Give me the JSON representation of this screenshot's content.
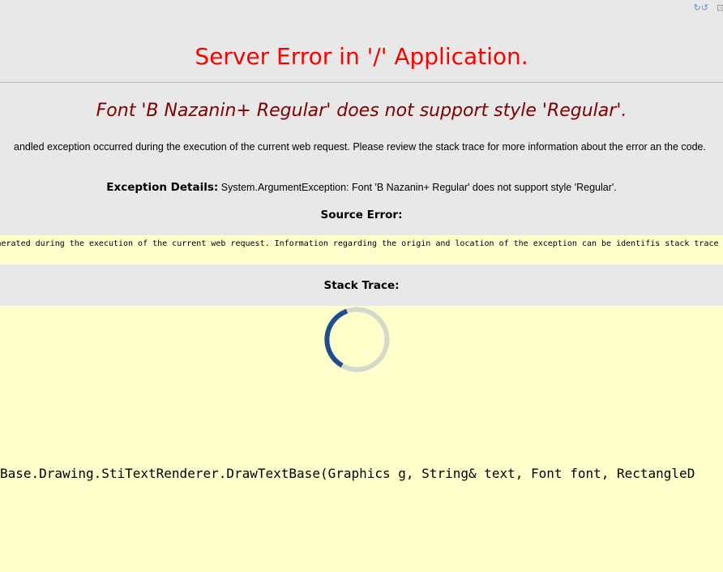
{
  "corner_icons": {
    "refresh_icon": "↻↺",
    "open_icon": "⊡"
  },
  "error": {
    "title": "Server Error in '/' Application.",
    "message": "Font 'B Nazanin+ Regular' does not support style 'Regular'.",
    "description": "andled exception occurred during the execution of the current web request. Please review the stack trace for more information about the error an the code.",
    "exception_label": "Exception Details:",
    "exception_text": "System.ArgumentException: Font 'B Nazanin+ Regular' does not support style 'Regular'."
  },
  "source_error": {
    "heading": "Source Error:",
    "text": "was generated during the execution of the current web request. Information regarding the origin and location of the exception can be identifis stack trace below."
  },
  "stack_trace": {
    "heading": "Stack Trace:",
    "line": "Base.Drawing.StiTextRenderer.DrawTextBase(Graphics g, String& text, Font font, RectangleD"
  },
  "colors": {
    "title": "#ff0000",
    "message": "#800000",
    "page_background": "#e8e8e8",
    "code_background": "#ffffcc",
    "spinner_active": "#1f4e8c",
    "spinner_track": "#d4dacb"
  },
  "icons": {
    "spinner": "loading-spinner-icon"
  }
}
